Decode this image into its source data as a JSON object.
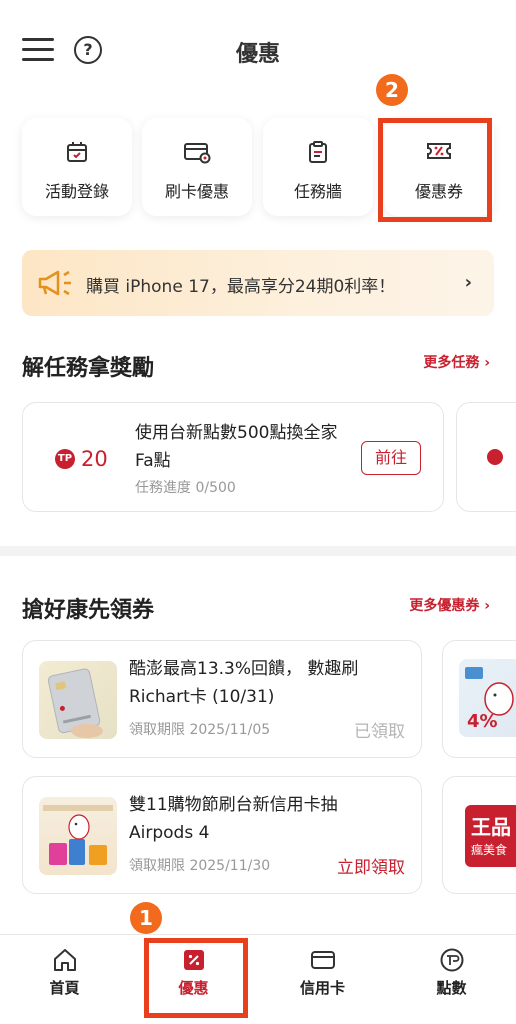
{
  "header": {
    "title": "優惠",
    "help_glyph": "?"
  },
  "tiles": [
    {
      "label": "活動登錄",
      "icon": "calendar-icon"
    },
    {
      "label": "刷卡優惠",
      "icon": "card-discount-icon"
    },
    {
      "label": "任務牆",
      "icon": "clipboard-icon"
    },
    {
      "label": "優惠券",
      "icon": "ticket-icon"
    }
  ],
  "steps": {
    "one": "1",
    "two": "2"
  },
  "banner": {
    "text": "購買 iPhone 17，最高享分24期0利率！",
    "chevron": "›"
  },
  "tasks_section": {
    "title": "解任務拿獎勵",
    "more": "更多任務 ›",
    "card": {
      "coin_glyph": "TP",
      "points": "20",
      "title": "使用台新點數500點換全家Fa點",
      "progress": "任務進度  0/500",
      "button": "前往"
    }
  },
  "coupons_section": {
    "title": "搶好康先領券",
    "more": "更多優惠券 ›",
    "items": [
      {
        "title": "酷澎最高13.3%回饋， 數趣刷Richart卡 (10/31)",
        "date": "領取期限  2025/11/05",
        "action": "已領取"
      },
      {
        "title": "雙11購物節刷台新信用卡抽Airpods 4",
        "date": "領取期限  2025/11/30",
        "action": "立即領取"
      }
    ],
    "peek_texts": {
      "second_card_badge": "4%",
      "third_card_brand": "王品",
      "third_card_sub": "瘋美食"
    }
  },
  "bottom_nav": [
    {
      "label": "首頁",
      "icon": "home-icon"
    },
    {
      "label": "優惠",
      "icon": "discount-icon"
    },
    {
      "label": "信用卡",
      "icon": "credit-card-icon"
    },
    {
      "label": "點數",
      "icon": "points-icon"
    }
  ],
  "colors": {
    "brand_red": "#c8202f",
    "highlight": "#e8401c",
    "badge_orange": "#f26a1b"
  }
}
